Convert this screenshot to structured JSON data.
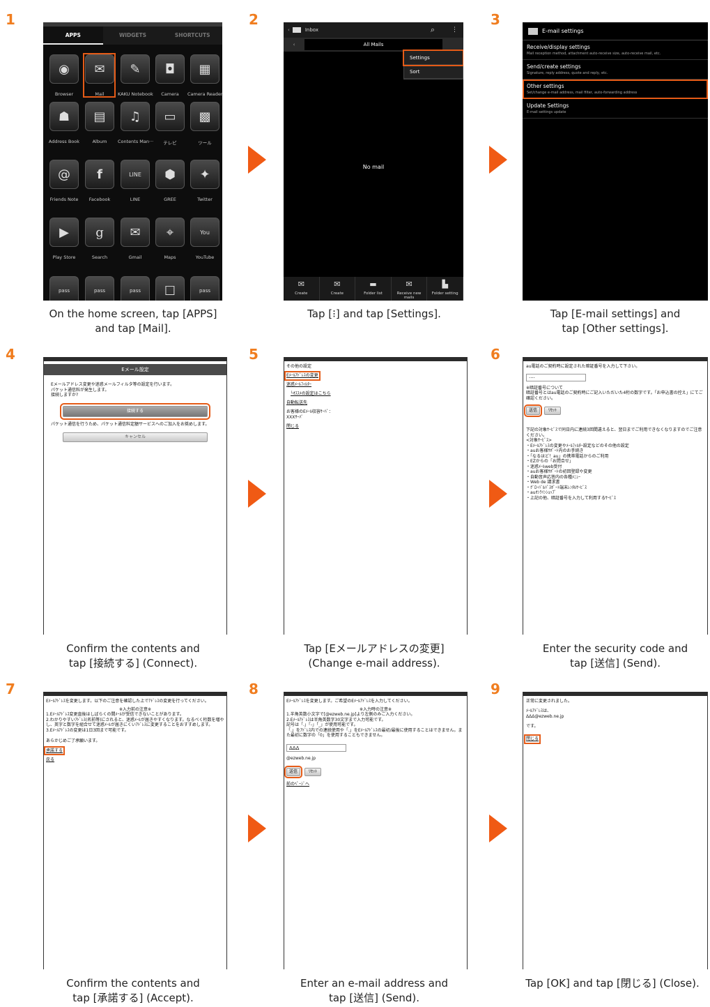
{
  "steps": [
    {
      "num": "1",
      "caption1": "On the home screen, tap [APPS]",
      "caption2": "and tap [Mail]."
    },
    {
      "num": "2",
      "caption1": "Tap [⁝] and tap [Settings].",
      "caption2": ""
    },
    {
      "num": "3",
      "caption1": "Tap [E-mail settings] and",
      "caption2": "tap [Other settings]."
    },
    {
      "num": "4",
      "caption1": "Confirm the contents and",
      "caption2": "tap [接続する] (Connect)."
    },
    {
      "num": "5",
      "caption1": "Tap [Eメールアドレスの変更]",
      "caption2": "(Change e-mail address)."
    },
    {
      "num": "6",
      "caption1": "Enter the security code and",
      "caption2": "tap [送信] (Send)."
    },
    {
      "num": "7",
      "caption1": "Confirm the contents and",
      "caption2": "tap [承諾する] (Accept)."
    },
    {
      "num": "8",
      "caption1": "Enter an e-mail address and",
      "caption2": "tap [送信] (Send)."
    },
    {
      "num": "9",
      "caption1": "Tap [OK] and tap [閉じる] (Close).",
      "caption2": ""
    }
  ],
  "s1": {
    "tabs": [
      "APPS",
      "WIDGETS",
      "SHORTCUTS"
    ],
    "apps": [
      [
        "Browser",
        "Mail",
        "KAKU Notebook",
        "Camera",
        "Camera Reader"
      ],
      [
        "Address Book",
        "Album",
        "Contents Man···",
        "テレビ",
        "ツール"
      ],
      [
        "Friends Note",
        "Facebook",
        "LINE",
        "GREE",
        "Twitter"
      ],
      [
        "Play Store",
        "Search",
        "Gmail",
        "Maps",
        "YouTube"
      ]
    ]
  },
  "s2": {
    "title": "Inbox",
    "all_mails": "All Mails",
    "menu": [
      "Settings",
      "Sort"
    ],
    "empty": "No mail",
    "bottom": [
      "Create",
      "Create",
      "Folder list",
      "Receive new mails",
      "Folder setting"
    ]
  },
  "s3": {
    "title": "E-mail settings",
    "items": [
      {
        "t": "Receive/display settings",
        "s": "Mail reception method, attachment auto-receive size, auto-receive mail, etc."
      },
      {
        "t": "Send/create settings",
        "s": "Signature, reply address, quote and reply, etc."
      },
      {
        "t": "Other settings",
        "s": "Set/change e-mail address, mail filter, auto-forwarding address"
      },
      {
        "t": "Update Settings",
        "s": "E-mail settings update"
      }
    ]
  },
  "s4": {
    "header": "Eメール設定",
    "text1": "Eメールアドレス変更や迷惑メールフィルタ等の設定を行います。",
    "text2": "パケット通信料が発生します。",
    "text3": "接続しますか?",
    "connect": "接続する",
    "note": "パケット通信を行うため、パケット通信料定額サービスへのご加入をお奨めします。",
    "cancel": "キャンセル"
  },
  "s5": {
    "lines": [
      "その他の設定",
      "Eﾒｰﾙｱﾄﾞﾚｽの変更",
      "迷惑ﾒｰﾙﾌｨﾙﾀｰ",
      "└ｵｽｽﾒの設定はこちら",
      "自動転送先",
      "お客様のEﾒｰﾙ収容ｻｰﾊﾞ：",
      "XXXｻｰﾊﾞ",
      "閉じる"
    ]
  },
  "s6": {
    "prompt": "au電話のご契約時に設定された暗証番号を入力して下さい。",
    "pin": "····",
    "about1": "※暗証番号について",
    "about2": "暗証番号とはau電話のご契約時にご記入いただいた4桁の数字です。「お申込書の控え」にてご確認ください。",
    "send": "送信",
    "reset": "ﾘｾｯﾄ",
    "warn": "下記の対象ｻｰﾋﾞｽで同日内に連続3回間違えると、翌日までご利用できなくなりますのでご注意ください。",
    "target": "<対象ｻｰﾋﾞｽ>",
    "list": [
      "・Eﾒｰﾙｱﾄﾞﾚｽの変更やﾒｰﾙﾌｨﾙﾀｰ設定などのその他の設定",
      "・auお客様ｻﾎﾟｰﾄ内のお手続き",
      "・「なるほど！au」の携帯電話からのご利用",
      "・EZからの「お問合せ」",
      "・迷惑ﾒｰﾙweb受付",
      "・auお客様ｻﾎﾟｰﾄの初回登録や変更",
      "・自動音声応答内の各種ﾒﾆｭｰ",
      "・Web de 請求書",
      "・ｸﾞﾛｰﾊﾞﾙﾊﾟｽﾎﾟｰﾄ端末ﾚﾝﾀﾙｻｰﾋﾞｽ",
      "・auｵﾝﾗｲﾝｼｮｯﾌﾟ",
      "・上記の他、暗証番号を入力して利用するｻｰﾋﾞｽ"
    ]
  },
  "s7": {
    "intro": "Eﾒｰﾙｱﾄﾞﾚｽを変更します。以下のご注意を確認した上でｱﾄﾞﾚｽの変更を行ってください。",
    "notice_title": "※入力前の注意※",
    "notes": [
      "1.Eﾒｰﾙｱﾄﾞﾚｽ変更直後はしばらくの間ﾒｰﾙが受信できないことがあります。",
      "2.わかりやすいｱﾄﾞﾚｽ(名前等)にされると、迷惑ﾒｰﾙが届きやすくなります。なるべく桁数を増やし、英字と数字を組合せて迷惑ﾒｰﾙが届きにくいｱﾄﾞﾚｽに変更することをおすすめします。",
      "3.Eﾒｰﾙｱﾄﾞﾚｽの変更は1日3回まで可能です。"
    ],
    "ack": "あらかじめご了承願います。",
    "accept": "承諾する",
    "back": "戻る"
  },
  "s8": {
    "intro": "Eﾒｰﾙｱﾄﾞﾚｽを変更します。ご希望のEﾒｰﾙｱﾄﾞﾚｽを入力してください。",
    "notice_title": "※入力時の注意※",
    "notes": [
      "1.半角英数小文字で[@ezweb.ne.jp]より左側のみご入力ください。",
      "2.Eﾒｰﾙｱﾄﾞﾚｽは半角英数字30文字まで入力可能です。",
      "記号は「.」「-」「_」が使用可能です。",
      "「.」をｱﾄﾞﾚｽ内での連続使用や「.」をEﾒｰﾙｱﾄﾞﾚｽの最初/最後に使用することはできません。また最初に数字の「0」を使用することもできません。"
    ],
    "input": "ΔΔΔ",
    "domain": "@ezweb.ne.jp",
    "send": "送信",
    "reset": "ﾘｾｯﾄ",
    "prev": "前のﾍﾟｰｼﾞへ"
  },
  "s9": {
    "line1": "正常に変更されました。",
    "line2": "ﾒｰﾙｱﾄﾞﾚｽは、",
    "line3": "ΔΔΔ@ezweb.ne.jp",
    "line4": "です。",
    "close": "閉じる"
  },
  "colors": {
    "accent": "#f07d1f",
    "arrow": "#f05a14",
    "highlight": "#e55b17"
  }
}
